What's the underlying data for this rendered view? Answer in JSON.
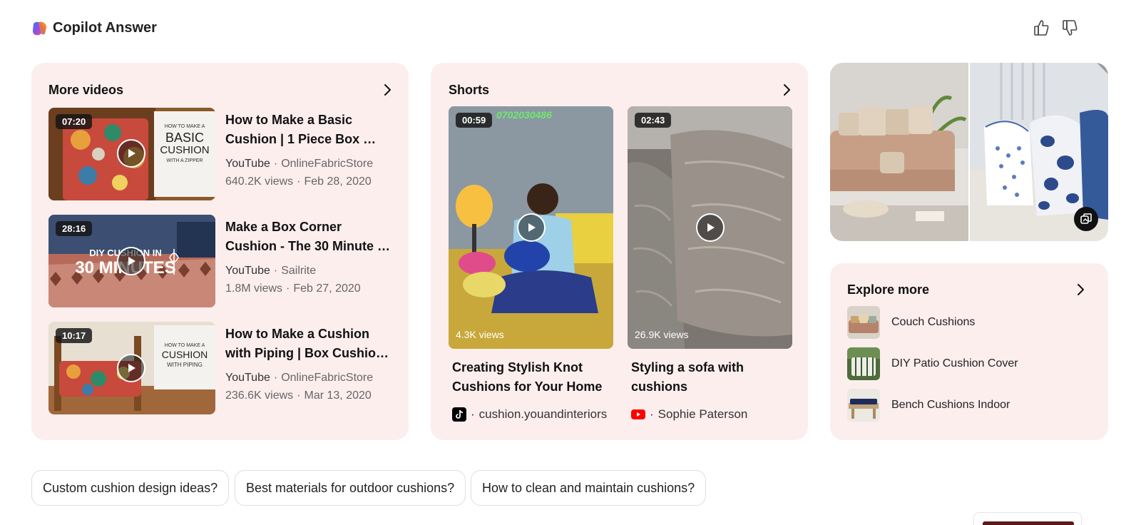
{
  "header": {
    "title": "Copilot Answer"
  },
  "more_videos": {
    "title": "More videos",
    "items": [
      {
        "duration": "07:20",
        "overlay_text": "HOW TO MAKE A BASIC CUSHION WITH A ZIPPER",
        "title": "How to Make a Basic Cushion | 1 Piece Box …",
        "source": "YouTube",
        "channel": "OnlineFabricStore",
        "views": "640.2K views",
        "date": "Feb 28, 2020"
      },
      {
        "duration": "28:16",
        "overlay_text": "DIY CUSHION IN 30 MINUTES",
        "title": "Make a Box Corner Cushion - The 30 Minute …",
        "source": "YouTube",
        "channel": "Sailrite",
        "views": "1.8M views",
        "date": "Feb 27, 2020"
      },
      {
        "duration": "10:17",
        "overlay_text": "HOW TO MAKE A CUSHION WITH PIPING",
        "title": "How to Make a Cushion with Piping | Box Cushio…",
        "source": "YouTube",
        "channel": "OnlineFabricStore",
        "views": "236.6K views",
        "date": "Mar 13, 2020"
      }
    ]
  },
  "shorts": {
    "title": "Shorts",
    "items": [
      {
        "duration": "00:59",
        "watermark": "0702030486",
        "views": "4.3K views",
        "title": "Creating Stylish Knot Cushions for Your Home",
        "source_icon": "tiktok-icon",
        "author": "cushion.youandinteriors"
      },
      {
        "duration": "02:43",
        "views": "26.9K views",
        "title": "Styling a sofa with cushions",
        "source_icon": "youtube-icon",
        "author": "Sophie Paterson"
      }
    ]
  },
  "explore": {
    "title": "Explore more",
    "items": [
      {
        "label": "Couch Cushions"
      },
      {
        "label": "DIY Patio Cushion Cover"
      },
      {
        "label": "Bench Cushions Indoor"
      }
    ]
  },
  "suggestions": [
    {
      "label": "Custom cushion design ideas?"
    },
    {
      "label": "Best materials for outdoor cushions?"
    },
    {
      "label": "How to clean and maintain cushions?"
    }
  ],
  "separator": "·"
}
